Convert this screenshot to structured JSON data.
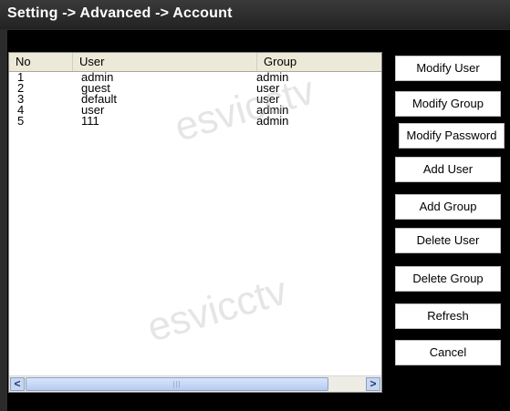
{
  "window": {
    "title": "Setting -> Advanced -> Account"
  },
  "table": {
    "columns": {
      "no": "No",
      "user": "User",
      "group": "Group"
    },
    "rows": [
      {
        "no": "1",
        "user": "admin",
        "group": "admin"
      },
      {
        "no": "2",
        "user": "guest",
        "group": "user"
      },
      {
        "no": "3",
        "user": "default",
        "group": "user"
      },
      {
        "no": "4",
        "user": "user",
        "group": "admin"
      },
      {
        "no": "5",
        "user": "111",
        "group": "admin"
      }
    ],
    "scrollbar": {
      "left_arrow": "<",
      "right_arrow": ">",
      "thumb_grip": "|||"
    }
  },
  "buttons": {
    "modify_user": "Modify User",
    "modify_group": "Modify Group",
    "modify_password": "Modify Password",
    "add_user": "Add User",
    "add_group": "Add Group",
    "delete_user": "Delete User",
    "delete_group": "Delete Group",
    "refresh": "Refresh",
    "cancel": "Cancel"
  },
  "watermark": "esvicctv"
}
